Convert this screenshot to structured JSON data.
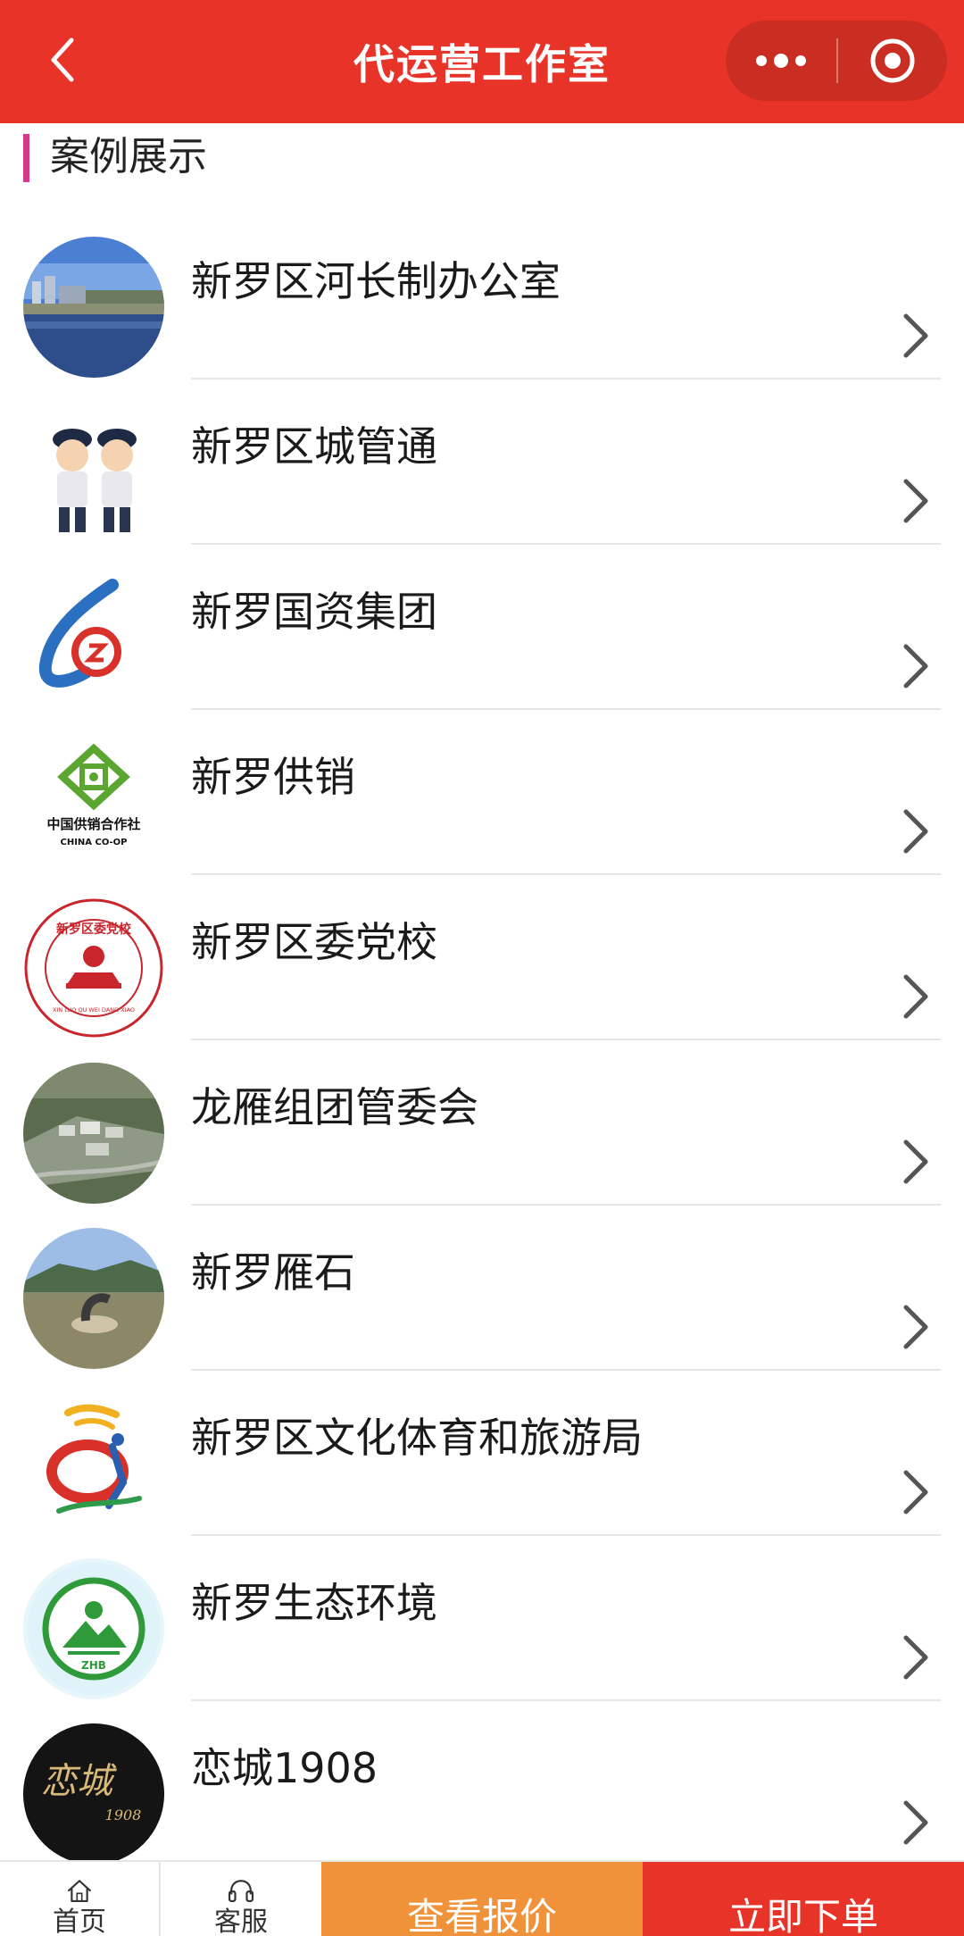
{
  "header": {
    "title": "代运营工作室",
    "back_icon": "back-chevron-icon",
    "more_icon": "more-dots-icon",
    "close_icon": "target-close-icon",
    "bg_color": "#e83428"
  },
  "section": {
    "title": "案例展示",
    "accent_color": "#d23a8a"
  },
  "cases": [
    {
      "name": "新罗区河长制办公室",
      "thumb": "river-city-photo"
    },
    {
      "name": "新罗区城管通",
      "thumb": "city-management-officers-cartoon"
    },
    {
      "name": "新罗国资集团",
      "thumb": "state-assets-logo"
    },
    {
      "name": "新罗供销",
      "thumb": "china-coop-logo",
      "logo_text": "中国供销合作社",
      "logo_subtext": "CHINA CO-OP"
    },
    {
      "name": "新罗区委党校",
      "thumb": "party-school-seal",
      "seal_text": "新罗区委党校",
      "seal_subtext": "XIN LUO QU WEI DANG XIAO"
    },
    {
      "name": "龙雁组团管委会",
      "thumb": "aerial-town-photo"
    },
    {
      "name": "新罗雁石",
      "thumb": "riverside-sculpture-photo"
    },
    {
      "name": "新罗区文化体育和旅游局",
      "thumb": "culture-sports-tourism-logo"
    },
    {
      "name": "新罗生态环境",
      "thumb": "ecology-environment-logo",
      "logo_text": "ZHB"
    },
    {
      "name": "恋城1908",
      "thumb": "liancheng-1908-logo",
      "logo_text": "恋城",
      "logo_subtext": "1908"
    }
  ],
  "bottom_bar": {
    "home_label": "首页",
    "service_label": "客服",
    "quote_label": "查看报价",
    "order_label": "立即下单",
    "quote_color": "#f0923a",
    "order_color": "#e83428"
  }
}
